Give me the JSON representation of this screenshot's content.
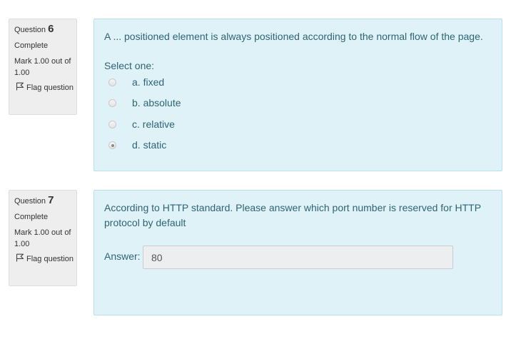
{
  "questions": [
    {
      "label": "Question",
      "number": "6",
      "state": "Complete",
      "grade": "Mark 1.00 out of 1.00",
      "flag": "Flag question",
      "text": "A ... positioned element is always positioned according to the normal flow of the page.",
      "prompt": "Select one:",
      "options": [
        {
          "label": "a. fixed",
          "checked": false
        },
        {
          "label": "b. absolute",
          "checked": false
        },
        {
          "label": "c. relative",
          "checked": false
        },
        {
          "label": "d. static",
          "checked": true
        }
      ]
    },
    {
      "label": "Question",
      "number": "7",
      "state": "Complete",
      "grade": "Mark 1.00 out of 1.00",
      "flag": "Flag question",
      "text": "According to HTTP standard. Please answer which port number is reserved for HTTP protocol by default",
      "answer_label": "Answer:",
      "answer_value": "80"
    }
  ],
  "colors": {
    "info_bg": "#eeeeee",
    "content_bg": "#def2f8",
    "content_border": "#b9e1ee",
    "content_text": "#2f6473"
  },
  "icons": {
    "flag": "flag-outline-icon",
    "radio": "radio-button"
  }
}
